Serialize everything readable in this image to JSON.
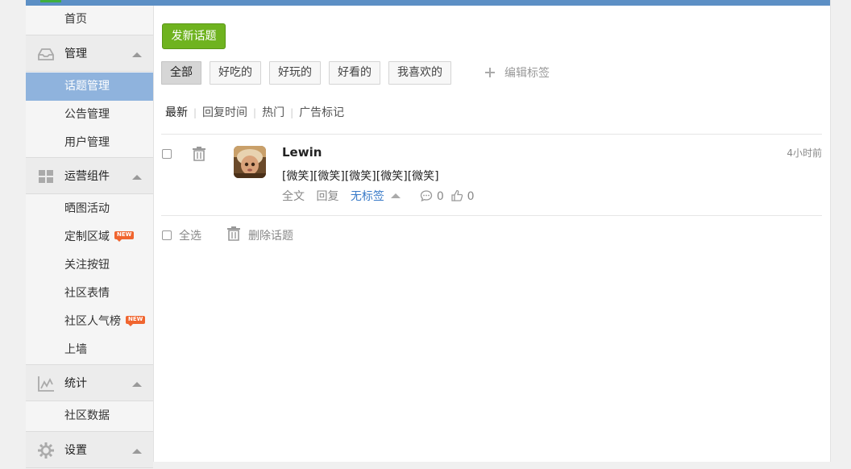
{
  "sidebar": {
    "home": "首页",
    "groups": {
      "manage": {
        "label": "管理",
        "icon": "inbox-icon"
      },
      "ops": {
        "label": "运营组件",
        "icon": "grid-icon"
      },
      "stats": {
        "label": "统计",
        "icon": "chart-icon"
      },
      "settings": {
        "label": "设置",
        "icon": "gear-icon"
      }
    },
    "manage_items": [
      "话题管理",
      "公告管理",
      "用户管理"
    ],
    "ops_items": [
      "晒图活动",
      "定制区域",
      "关注按钮",
      "社区表情",
      "社区人气榜",
      "上墙"
    ],
    "stats_items": [
      "社区数据"
    ],
    "new_badge": "NEW",
    "active_item": "话题管理"
  },
  "main": {
    "post_button": "发新话题",
    "tags": [
      "全部",
      "好吃的",
      "好玩的",
      "好看的",
      "我喜欢的"
    ],
    "active_tag": "全部",
    "edit_tags": "编辑标签",
    "sort": [
      "最新",
      "回复时间",
      "热门",
      "广告标记"
    ],
    "active_sort": "最新",
    "topic": {
      "author": "Lewin",
      "time": "4小时前",
      "content": "[微笑][微笑][微笑][微笑][微笑]",
      "full_text": "全文",
      "reply": "回复",
      "tag_label": "无标签",
      "comment_count": "0",
      "like_count": "0"
    },
    "bulk": {
      "select_all": "全选",
      "delete": "删除话题"
    }
  },
  "colors": {
    "topbar": "#5c8fc5",
    "active_sidebar": "#8fb3dd",
    "post_button": "#6fb31f",
    "link": "#3a7bc8",
    "new_badge": "#f0652f"
  }
}
